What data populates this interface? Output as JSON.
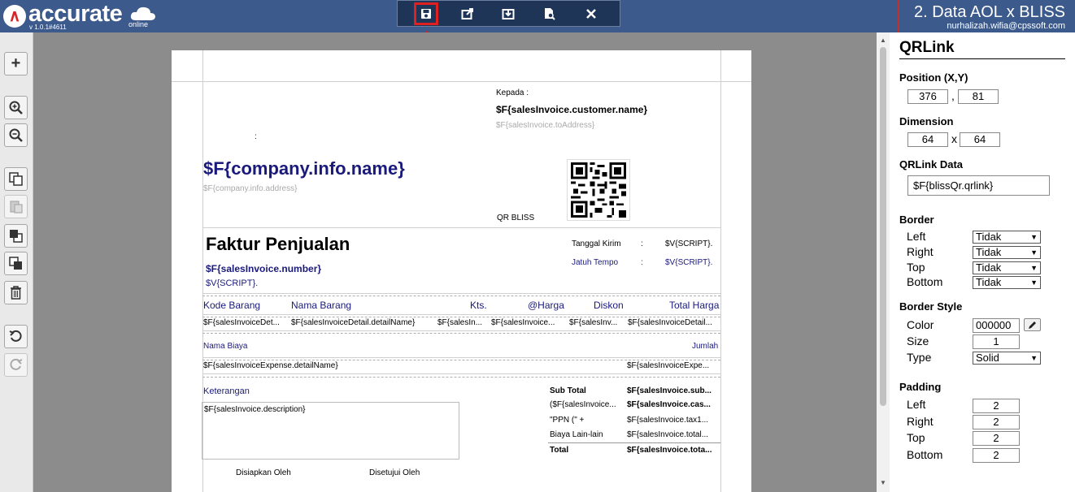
{
  "header": {
    "logo_text": "accurate",
    "logo_sub": "online",
    "version": "v 1.0.1#4611",
    "title": "2. Data AOL x BLISS",
    "user_email": "nurhalizah.wifia@cpssoft.com"
  },
  "toolbar": {
    "icons": [
      "save-icon",
      "export-icon",
      "import-icon",
      "preview-icon",
      "close-icon"
    ]
  },
  "sidebar": {
    "icons": [
      "add-icon",
      "zoom-in-icon",
      "zoom-out-icon",
      "copy-icon",
      "paste-icon",
      "bring-front-icon",
      "send-back-icon",
      "delete-icon",
      "undo-icon",
      "redo-icon"
    ]
  },
  "document": {
    "kepada_label": "Kepada :",
    "customer_name": "$F{salesInvoice.customer.name}",
    "to_address": "$F{salesInvoice.toAddress}",
    "colon": ":",
    "company_name": "$F{company.info.name}",
    "company_address": "$F{company.info.address}",
    "qr_label": "QR BLISS",
    "invoice_title": "Faktur Penjualan",
    "invoice_number": "$F{salesInvoice.number}",
    "script1": "$V{SCRIPT}.",
    "tanggal_kirim": "Tanggal Kirim",
    "jatuh_tempo": "Jatuh Tempo",
    "sep": ":",
    "script_val": "$V{SCRIPT}.",
    "columns": [
      "Kode Barang",
      "Nama Barang",
      "Kts.",
      "@Harga",
      "Diskon",
      "Total Harga"
    ],
    "row_cells": [
      "$F{salesInvoiceDet...",
      "$F{salesInvoiceDetail.detailName}",
      "$F{salesIn...",
      "$F{salesInvoice...",
      "$F{salesInv...",
      "$F{salesInvoiceDetail..."
    ],
    "nama_biaya": "Nama Biaya",
    "jumlah": "Jumlah",
    "expense_name": "$F{salesInvoiceExpense.detailName}",
    "expense_amount": "$F{salesInvoiceExpe...",
    "keterangan": "Keterangan",
    "description": "$F{salesInvoice.description}",
    "totals": [
      {
        "label": "Sub Total",
        "value": "$F{salesInvoice.sub..."
      },
      {
        "label": "($F{salesInvoice...",
        "value": "$F{salesInvoice.cas..."
      },
      {
        "label": "\"PPN (\" +",
        "value": "$F{salesInvoice.tax1..."
      },
      {
        "label": "Biaya Lain-lain",
        "value": "$F{salesInvoice.total..."
      },
      {
        "label": "Total",
        "value": "$F{salesInvoice.tota..."
      }
    ],
    "disiapkan": "Disiapkan Oleh",
    "disetujui": "Disetujui Oleh"
  },
  "panel": {
    "title": "QRLink",
    "position_label": "Position (X,Y)",
    "pos_x": "376",
    "pos_sep": ",",
    "pos_y": "81",
    "dimension_label": "Dimension",
    "dim_w": "64",
    "dim_sep": "x",
    "dim_h": "64",
    "data_label": "QRLink Data",
    "data_value": "$F{blissQr.qrlink}",
    "border_label": "Border",
    "border_rows": [
      {
        "label": "Left",
        "value": "Tidak"
      },
      {
        "label": "Right",
        "value": "Tidak"
      },
      {
        "label": "Top",
        "value": "Tidak"
      },
      {
        "label": "Bottom",
        "value": "Tidak"
      }
    ],
    "border_style_label": "Border Style",
    "color_label": "Color",
    "color_value": "000000",
    "size_label": "Size",
    "size_value": "1",
    "type_label": "Type",
    "type_value": "Solid",
    "padding_label": "Padding",
    "padding_rows": [
      {
        "label": "Left",
        "value": "2"
      },
      {
        "label": "Right",
        "value": "2"
      },
      {
        "label": "Top",
        "value": "2"
      },
      {
        "label": "Bottom",
        "value": "2"
      }
    ]
  },
  "colors": {
    "header_bg": "#3c5a8c",
    "toolbar_bg": "#1f3558",
    "highlight": "#e02020",
    "navy_text": "#1a1a7c"
  }
}
